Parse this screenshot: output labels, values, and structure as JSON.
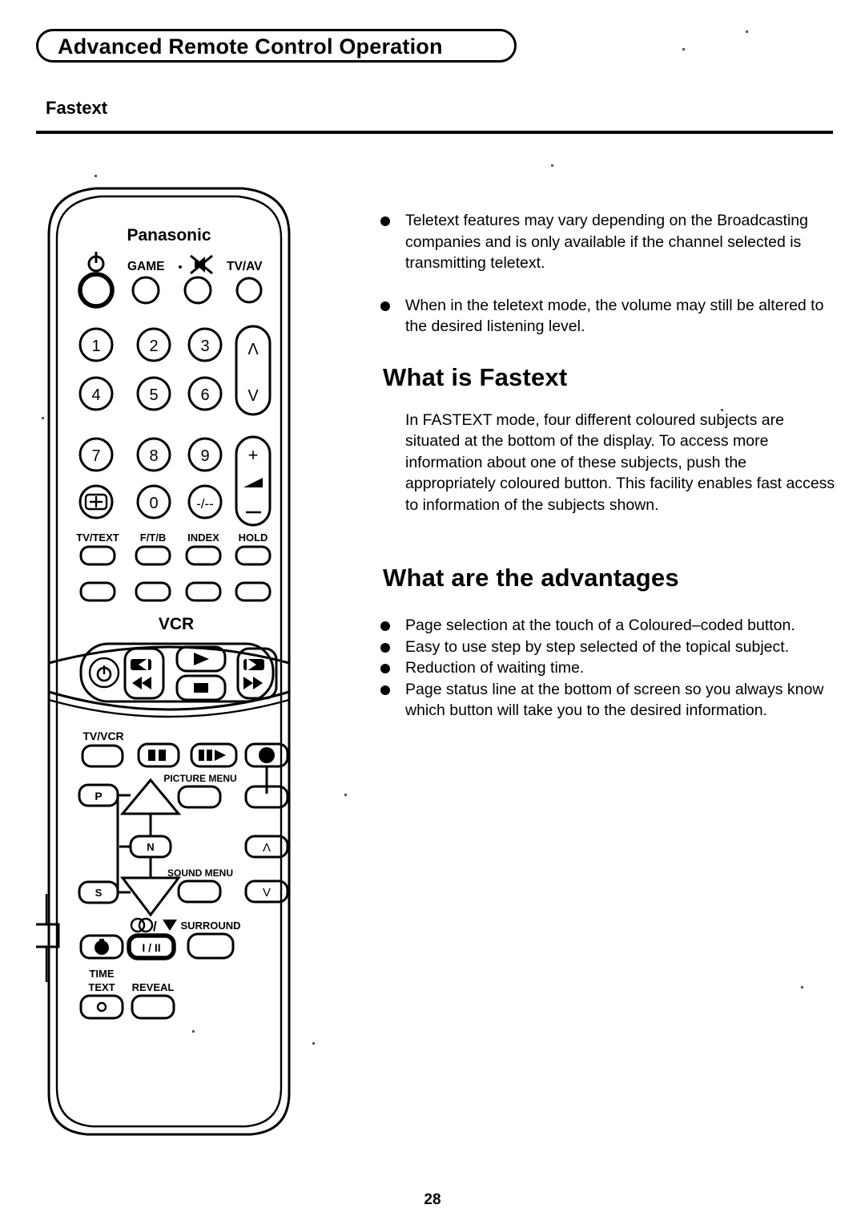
{
  "header": {
    "banner_title": "Advanced Remote Control Operation",
    "subsection": "Fastext"
  },
  "notes": [
    "Teletext features may vary depending on the Broadcasting companies and is only available if the channel selected is transmitting teletext.",
    "When in the teletext mode, the volume may still be altered to the desired listening level."
  ],
  "what_is": {
    "heading": "What is Fastext",
    "body": "In FASTEXT mode, four different coloured subjects are situated at the bottom of the display. To access more information about one of these subjects, push the appropriately coloured button. This facility enables fast access to information of the subjects shown."
  },
  "advantages": {
    "heading": "What are the advantages",
    "items": [
      "Page selection at the touch of a Coloured–coded button.",
      "Easy to use step by step selected of the topical subject.",
      "Reduction of waiting time.",
      "Page status line at the bottom of screen so you always know which button will take you to the desired information."
    ]
  },
  "remote": {
    "brand": "Panasonic",
    "top_row_labels": {
      "power": "power-icon",
      "game": "GAME",
      "mute": "mute-icon",
      "tv_av": "TV/AV"
    },
    "keypad": [
      [
        "1",
        "2",
        "3"
      ],
      [
        "4",
        "5",
        "6"
      ],
      [
        "7",
        "8",
        "9"
      ],
      [
        "pip-icon",
        "0",
        "-/--"
      ]
    ],
    "channel_rocker": {
      "up": "Λ",
      "down": "V"
    },
    "volume_rocker": {
      "up": "+",
      "mid": "volume-icon",
      "down": "–"
    },
    "teletext_labels": [
      "TV/TEXT",
      "F/T/B",
      "INDEX",
      "HOLD"
    ],
    "vcr_label": "VCR",
    "vcr_buttons": [
      "power-icon",
      "rewind-icon",
      "play-icon",
      "stop-icon",
      "forward-icon"
    ],
    "tv_vcr_label": "TV/VCR",
    "transport_buttons": [
      "pause-icon",
      "slow-icon",
      "record-icon"
    ],
    "nav": {
      "p": "P",
      "n": "N",
      "s": "S",
      "up": "up-triangle-icon",
      "down": "down-triangle-icon"
    },
    "picture_menu_label": "PICTURE MENU",
    "sound_menu_label": "SOUND MENU",
    "menu_rocker": {
      "up": "Λ",
      "down": "V"
    },
    "stereo_symbol": "stereo-mono-icon",
    "stereo_button": "I/II",
    "surround_label": "SURROUND",
    "time_text_label": "TIME\nTEXT",
    "reveal_label": "REVEAL",
    "hand_button": "hand-icon",
    "time_text_button": "dot-icon"
  },
  "footer": {
    "page_number": "28"
  }
}
